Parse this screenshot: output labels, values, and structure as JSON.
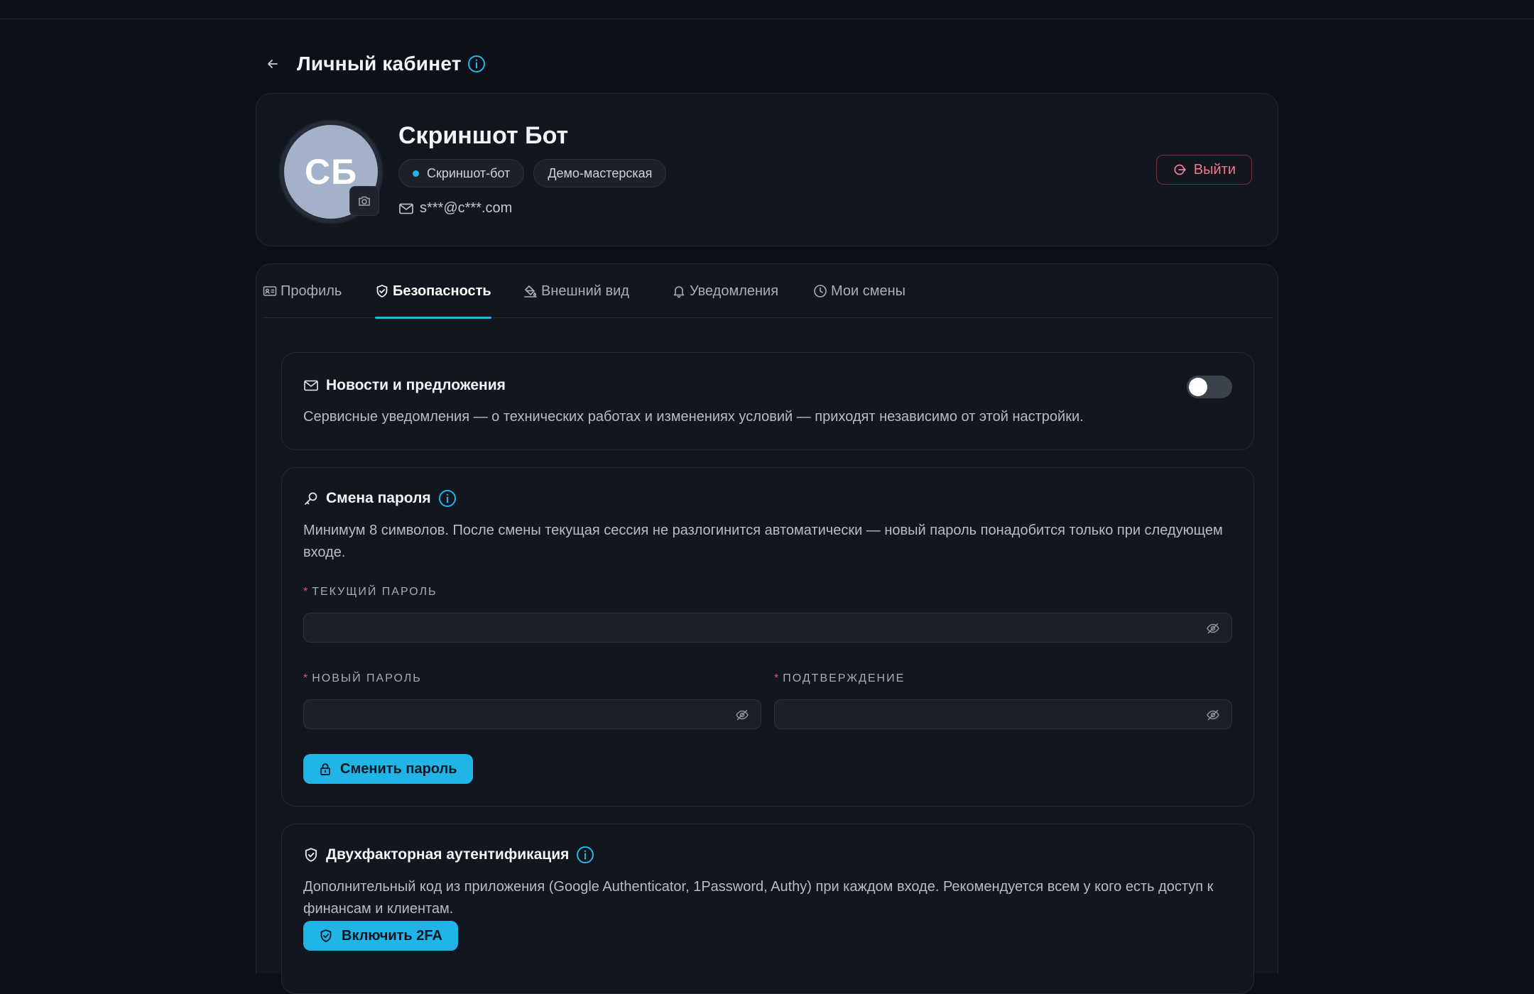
{
  "header": {
    "title": "Личный кабинет"
  },
  "profile": {
    "initials": "СБ",
    "name": "Скриншот Бот",
    "role_chip": "Скриншот-бот",
    "workshop_chip": "Демо-мастерская",
    "email": "s***@c***.com",
    "logout_label": "Выйти"
  },
  "tabs": [
    {
      "label": "Профиль",
      "icon": "id-card-icon"
    },
    {
      "label": "Безопасность",
      "icon": "shield-check-icon",
      "active": true
    },
    {
      "label": "Внешний вид",
      "icon": "paint-bucket-icon"
    },
    {
      "label": "Уведомления",
      "icon": "bell-icon"
    },
    {
      "label": "Мои смены",
      "icon": "clock-icon"
    }
  ],
  "news": {
    "title": "Новости и предложения",
    "description": "Сервисные уведомления — о технических работах и изменениях условий — приходят независимо от этой настройки.",
    "enabled": false
  },
  "password": {
    "title": "Смена пароля",
    "description": "Минимум 8 символов. После смены текущая сессия не разлогинится автоматически — новый пароль понадобится только при следующем входе.",
    "required_mark": "*",
    "current_label": "ТЕКУЩИЙ ПАРОЛЬ",
    "new_label": "НОВЫЙ ПАРОЛЬ",
    "confirm_label": "ПОДТВЕРЖДЕНИЕ",
    "current_value": "",
    "new_value": "",
    "confirm_value": "",
    "submit_label": "Сменить пароль"
  },
  "twofa": {
    "title": "Двухфакторная аутентификация",
    "description": "Дополнительный код из приложения (Google Authenticator, 1Password, Authy) при каждом входе. Рекомендуется всем у кого есть доступ к финансам и клиентам.",
    "enable_label": "Включить 2FA"
  },
  "colors": {
    "accent": "#20b5e6",
    "danger": "#f07a8c",
    "background": "#0c1018",
    "card": "#12161e"
  }
}
